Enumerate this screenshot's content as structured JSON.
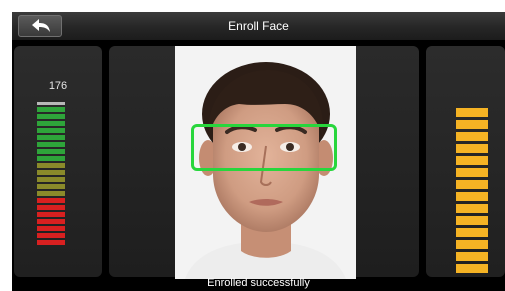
{
  "header": {
    "title": "Enroll Face",
    "back_icon": "back-arrow-icon"
  },
  "quality_meter": {
    "value": "176",
    "colors": {
      "top": "#b8b8b8",
      "green": "#2ea43a",
      "olive": "#8a8a2a",
      "red": "#d82020"
    }
  },
  "progress_meter": {
    "color": "#f5b324",
    "segments_lit": 14
  },
  "status": {
    "message": "Enrolled successfully"
  },
  "face_detection": {
    "box_color": "#28d63c"
  }
}
